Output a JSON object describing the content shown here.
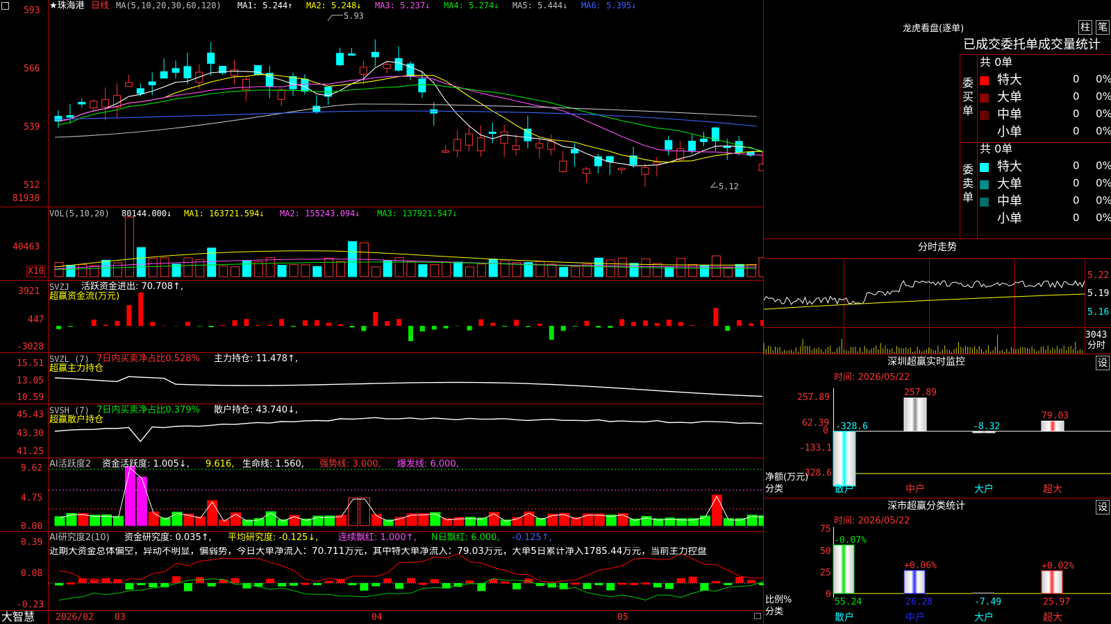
{
  "stock": {
    "name": "★珠海港",
    "period": "日线"
  },
  "main_axis": [
    "593",
    "566",
    "539",
    "512"
  ],
  "ma_line": {
    "label": "MA(5,10,20,30,60,120)",
    "items": [
      {
        "text": "MA1: 5.244↑",
        "color": "#ffffff"
      },
      {
        "text": "MA2: 5.248↓",
        "color": "#ffff00"
      },
      {
        "text": "MA3: 5.237↓",
        "color": "#ff50ff"
      },
      {
        "text": "MA4: 5.274↓",
        "color": "#00e600"
      },
      {
        "text": "MA5: 5.444↓",
        "color": "#c0c0c0"
      },
      {
        "text": "MA6: 5.395↓",
        "color": "#3c64ff"
      }
    ]
  },
  "annotations": {
    "high": "5.93",
    "low": "5.12"
  },
  "vol": {
    "label": "VOL(5,10,20)",
    "value": "80144.000↓",
    "items": [
      {
        "text": "MA1: 163721.594↓",
        "color": "#ffff00"
      },
      {
        "text": "MA2: 155243.094↓",
        "color": "#ff50ff"
      },
      {
        "text": "MA3: 137921.547↓",
        "color": "#00e600"
      }
    ],
    "axis": [
      "81938",
      "40463"
    ],
    "unit": "X10"
  },
  "svzj": {
    "label": "SVZJ",
    "text": "活跃资金进出: 70.708↑,",
    "sub": "超赢资金流(万元)",
    "axis": [
      "3921",
      "447",
      "-3028"
    ]
  },
  "svzl": {
    "label": "SVZL (7)",
    "t1": "7日内买卖净占比0.528%",
    "t2": "主力持仓: 11.478↑,",
    "sub": "超赢主力持仓",
    "axis": [
      "15.51",
      "13.05",
      "10.59"
    ]
  },
  "svsh": {
    "label": "SVSH (7)",
    "t1": "7日内买卖净占比0.379%",
    "t2": "散户持仓: 43.740↓,",
    "sub": "超赢散户持仓",
    "axis": [
      "45.43",
      "43.30",
      "41.25"
    ]
  },
  "ai1": {
    "label": "AI活跃度2",
    "t1": "资金活跃度: 1.005↓,",
    "t2": "9.616,",
    "t3": "生命线: 1.560,",
    "t4": "强势线: 3.000,",
    "t5": "爆发线: 6.000,",
    "axis": [
      "9.62",
      "4.75",
      "0.00"
    ]
  },
  "ai2": {
    "label": "AI研究度2(10)",
    "t1": "资金研究度: 0.035↑,",
    "t2": "平均研究度: -0.125↓,",
    "t3": "连续飘红: 1.000↑,",
    "t4": "N日飘红: 6.000,",
    "t5": "-0.125↑,",
    "commentary": "近期大资金总体偏空，异动不明显，偏弱势，今日大单净流入：70.711万元，其中特大单净流入：79.03万元，大单5日累计净入1785.44万元，当前主力控盘",
    "axis": [
      "0.39",
      "0.08",
      "-0.23"
    ]
  },
  "footer": {
    "brand": "大智慧",
    "dates": [
      "2026/02",
      "03",
      "04",
      "05"
    ]
  },
  "lhb": {
    "title": "龙虎看盘(逐单)",
    "btns": [
      "柱",
      "笔"
    ],
    "header": "已成交委托单成交量统计",
    "buy": {
      "side": "委买单",
      "total": "共 0单",
      "rows": [
        {
          "name": "特大",
          "v": "0",
          "p": "0%"
        },
        {
          "name": "大单",
          "v": "0",
          "p": "0%"
        },
        {
          "name": "中单",
          "v": "0",
          "p": "0%"
        },
        {
          "name": "小单",
          "v": "0",
          "p": "0%"
        }
      ],
      "colors": [
        "#ff0000",
        "#8b0000",
        "#6b0000",
        "#000000"
      ]
    },
    "sell": {
      "side": "委卖单",
      "total": "共 0单",
      "rows": [
        {
          "name": "特大",
          "v": "0",
          "p": "0%"
        },
        {
          "name": "大单",
          "v": "0",
          "p": "0%"
        },
        {
          "name": "中单",
          "v": "0",
          "p": "0%"
        },
        {
          "name": "小单",
          "v": "0",
          "p": "0%"
        }
      ],
      "colors": [
        "#00ffff",
        "#008b8b",
        "#006b6b",
        "#000000"
      ]
    }
  },
  "fenshi": {
    "title": "分时走势",
    "axis": [
      "5.22",
      "5.19",
      "5.16"
    ],
    "vol": "3043",
    "vol_label": "分时"
  },
  "monitor": {
    "title": "深圳超赢实时监控",
    "btn": "设",
    "time": "时间: 2026/05/22",
    "axis": [
      "257.89",
      "62.39",
      "0",
      "-133.1",
      "-328.6"
    ],
    "ylabel": "净额(万元)",
    "xlabel": "分类",
    "categories": [
      "散户",
      "中户",
      "大户",
      "超大"
    ],
    "values": [
      -328.6,
      257.89,
      -8.32,
      79.03
    ],
    "value_labels": [
      "-328.6",
      "257.89",
      "-8.32",
      "79.03"
    ]
  },
  "classify": {
    "title": "深市超赢分类统计",
    "btn": "设",
    "time": "时间: 2026/05/22",
    "axis": [
      "75",
      "50",
      "25",
      "0"
    ],
    "ylabel": "比例%",
    "xlabel": "分类",
    "categories": [
      "散户",
      "中户",
      "大户",
      "超大"
    ],
    "values": [
      55.24,
      26.28,
      -7.49,
      25.97
    ],
    "changes": [
      "-0.07%",
      "+0.06%",
      "",
      "+0.02%"
    ],
    "value_labels": [
      "55.24",
      "26.28",
      "-7.49",
      "25.97"
    ]
  }
}
